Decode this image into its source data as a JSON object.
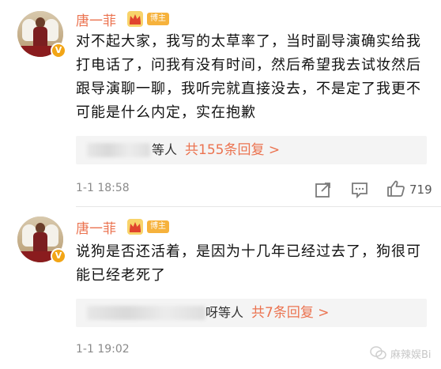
{
  "comments": [
    {
      "username": "唐一菲",
      "role_badge": "博主",
      "text": "对不起大家，我写的太草率了，当时副导演确实给我打电话了，问我有没有时间，然后希望我去试妆然后跟导演聊一聊，我听完就直接没去，不是定了我更不可能是什么内定，实在抱歉",
      "reply_suffix": "等人",
      "reply_count_label": "共155条回复 >",
      "time": "1-1 18:58",
      "likes": "719"
    },
    {
      "username": "唐一菲",
      "role_badge": "博主",
      "text": "说狗是否还活着，是因为十几年已经过去了，狗很可能已经老死了",
      "reply_suffix": "呀等人",
      "reply_count_label": "共7条回复 >",
      "time": "1-1 19:02",
      "likes": ""
    }
  ],
  "watermark": {
    "text": "麻辣娱Bi"
  },
  "colors": {
    "accent": "#eb7350",
    "badge": "#f6b23c",
    "verified": "#f2a516"
  },
  "icons": {
    "share": "share-icon",
    "comment": "comment-icon",
    "like": "thumbs-up-icon",
    "verified": "verified-v-icon",
    "crown": "crown-icon"
  }
}
